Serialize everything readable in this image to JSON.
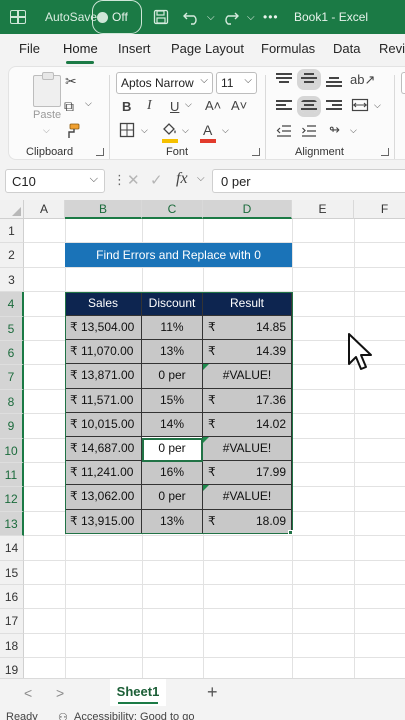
{
  "titlebar": {
    "autosave_label": "AutoSave",
    "autosave_state": "Off",
    "document_title": "Book1 - Excel"
  },
  "tabs": [
    "File",
    "Home",
    "Insert",
    "Page Layout",
    "Formulas",
    "Data",
    "Revi"
  ],
  "active_tab": "Home",
  "ribbon": {
    "clipboard": {
      "paste_label": "Paste",
      "group_label": "Clipboard"
    },
    "font": {
      "font_name": "Aptos Narrow",
      "font_size": "11",
      "group_label": "Font"
    },
    "alignment": {
      "group_label": "Alignment"
    }
  },
  "formula_bar": {
    "name_box": "C10",
    "content": "0 per"
  },
  "columns": [
    "A",
    "B",
    "C",
    "D",
    "E",
    "F"
  ],
  "rows": [
    "1",
    "2",
    "3",
    "4",
    "5",
    "6",
    "7",
    "8",
    "9",
    "10",
    "11",
    "12",
    "13",
    "14",
    "15",
    "16",
    "17",
    "18",
    "19"
  ],
  "sheet": {
    "title": "Find Errors and Replace with 0",
    "headers": [
      "Sales",
      "Discount",
      "Result"
    ],
    "currency": "₹",
    "rows": [
      {
        "sales": "₹ 13,504.00",
        "discount": "11%",
        "result": "14.85",
        "error": false
      },
      {
        "sales": "₹ 11,070.00",
        "discount": "13%",
        "result": "14.39",
        "error": false
      },
      {
        "sales": "₹ 13,871.00",
        "discount": "0 per",
        "result": "#VALUE!",
        "error": true
      },
      {
        "sales": "₹ 11,571.00",
        "discount": "15%",
        "result": "17.36",
        "error": false
      },
      {
        "sales": "₹ 10,015.00",
        "discount": "14%",
        "result": "14.02",
        "error": false
      },
      {
        "sales": "₹ 14,687.00",
        "discount": "0 per",
        "result": "#VALUE!",
        "error": true
      },
      {
        "sales": "₹ 11,241.00",
        "discount": "16%",
        "result": "17.99",
        "error": false
      },
      {
        "sales": "₹ 13,062.00",
        "discount": "0 per",
        "result": "#VALUE!",
        "error": true
      },
      {
        "sales": "₹ 13,915.00",
        "discount": "13%",
        "result": "18.09",
        "error": false
      }
    ]
  },
  "sheet_tabs": {
    "active": "Sheet1",
    "add": "+"
  },
  "statusbar": {
    "ready": "Ready",
    "accessibility": "Accessibility: Good to go"
  },
  "colors": {
    "brand": "#1b7a45",
    "title_fill": "#1a73b8",
    "header_fill": "#0d2550",
    "body_fill": "#c8c8c8"
  }
}
